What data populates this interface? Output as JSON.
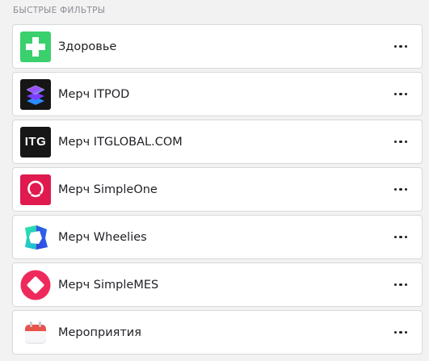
{
  "section": {
    "title": "БЫСТРЫЕ ФИЛЬТРЫ"
  },
  "filters": [
    {
      "label": "Здоровье",
      "icon": "health-cross-icon",
      "color": "#3ad06e"
    },
    {
      "label": "Мерч ITPOD",
      "icon": "itpod-logo-icon",
      "color": "#161616"
    },
    {
      "label": "Мерч ITGLOBAL.COM",
      "icon": "itglobal-logo-icon",
      "color": "#161616",
      "logo_text": "ITG"
    },
    {
      "label": "Мерч SimpleOne",
      "icon": "simpleone-logo-icon",
      "color": "#e01a4f"
    },
    {
      "label": "Мерч Wheelies",
      "icon": "wheelies-logo-icon",
      "color": "#22c4d4"
    },
    {
      "label": "Мерч SimpleMES",
      "icon": "simplemes-logo-icon",
      "color": "#ee2a5c"
    },
    {
      "label": "Мероприятия",
      "icon": "calendar-icon",
      "color": "#e8534a"
    }
  ]
}
